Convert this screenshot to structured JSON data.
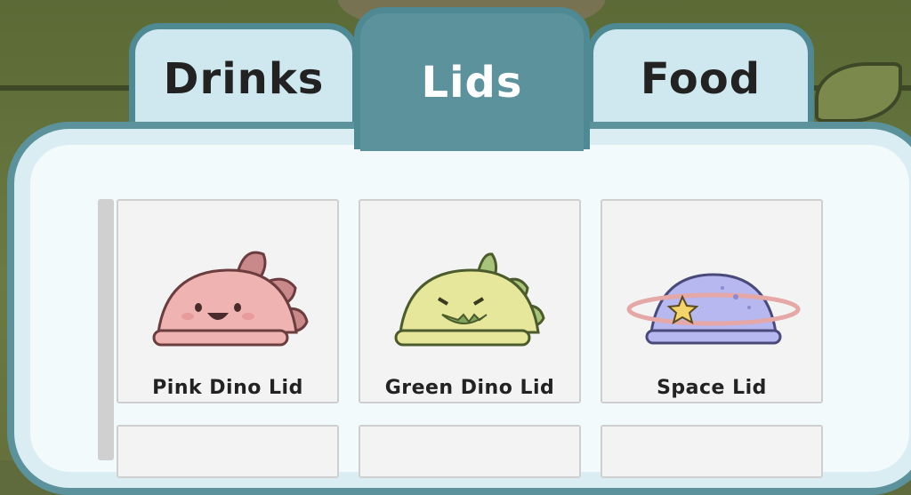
{
  "tabs": [
    {
      "label": "Drinks",
      "active": false
    },
    {
      "label": "Lids",
      "active": true
    },
    {
      "label": "Food",
      "active": false
    }
  ],
  "items": [
    {
      "label": "Pink Dino Lid",
      "icon": "pink-dino-lid-icon"
    },
    {
      "label": "Green Dino Lid",
      "icon": "green-dino-lid-icon"
    },
    {
      "label": "Space Lid",
      "icon": "space-lid-icon"
    }
  ],
  "colors": {
    "tab_active": "#5c929c",
    "tab_inactive": "#cfe8ef",
    "panel_border": "#5c929c",
    "panel_bg": "#f3fafc"
  }
}
